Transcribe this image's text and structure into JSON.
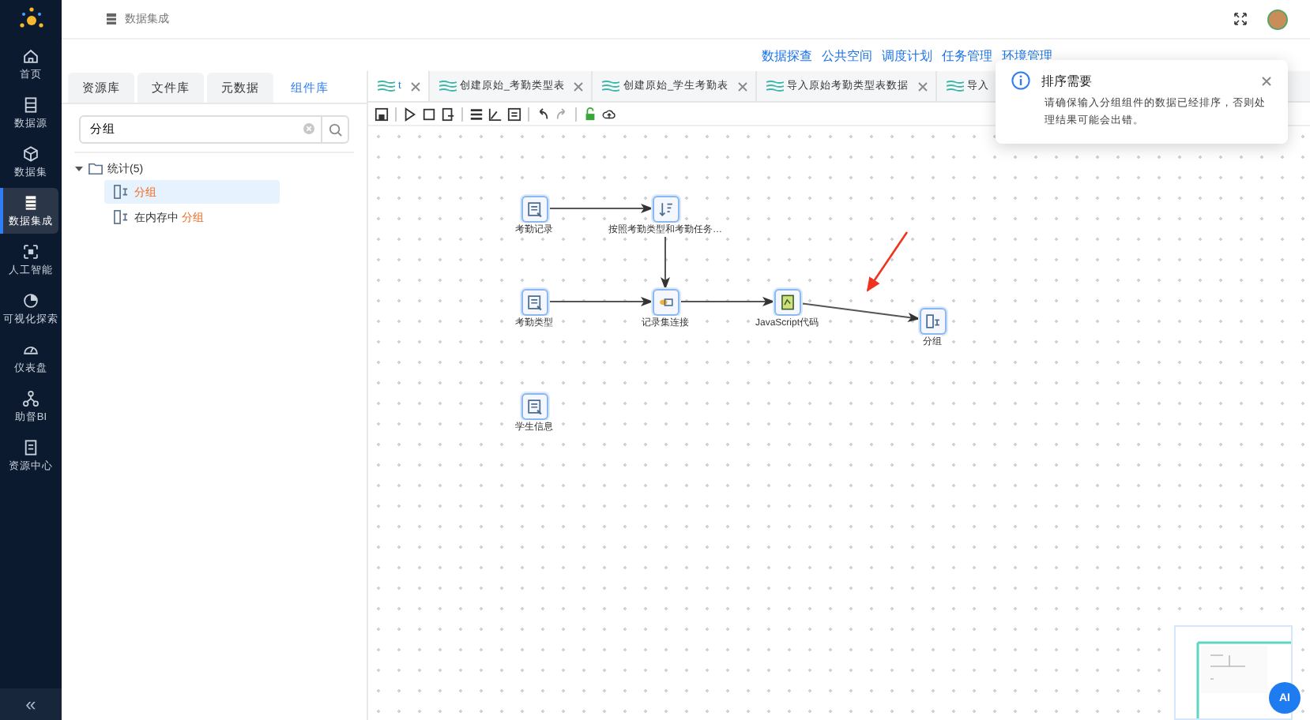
{
  "sidebar": {
    "items": [
      {
        "label": "首页",
        "selected": false
      },
      {
        "label": "数据源",
        "selected": false
      },
      {
        "label": "数据集",
        "selected": false
      },
      {
        "label": "数据集成",
        "selected": true
      },
      {
        "label": "人工智能",
        "selected": false
      },
      {
        "label": "可视化探索",
        "selected": false
      },
      {
        "label": "仪表盘",
        "selected": false
      },
      {
        "label": "助督BI",
        "selected": false
      },
      {
        "label": "资源中心",
        "selected": false
      }
    ],
    "collapse": "«"
  },
  "header": {
    "breadcrumb": "数据集成"
  },
  "top_links": [
    "数据探查",
    "公共空间",
    "调度计划",
    "任务管理",
    "环境管理"
  ],
  "library": {
    "tabs": [
      {
        "label": "资源库",
        "selected": false
      },
      {
        "label": "文件库",
        "selected": false
      },
      {
        "label": "元数据",
        "selected": false
      },
      {
        "label": "组件库",
        "selected": true
      }
    ],
    "search": {
      "value": "分组"
    },
    "tree": [
      {
        "label": "统计(5)",
        "expanded": true,
        "children": [
          {
            "match": "分组",
            "selected": true
          },
          {
            "prefix": "在内存中",
            "match": "分组",
            "selected": false
          }
        ]
      }
    ]
  },
  "editor_tabs": [
    {
      "label": "t",
      "selected": true
    },
    {
      "label": "创建原始_考勤类型表",
      "selected": false
    },
    {
      "label": "创建原始_学生考勤表",
      "selected": false
    },
    {
      "label": "导入原始考勤类型表数据",
      "selected": false
    },
    {
      "label": "导入",
      "selected": false
    }
  ],
  "nodes": [
    {
      "label": "考勤记录",
      "kind": "input"
    },
    {
      "label": "按照考勤类型和考勤任务…",
      "kind": "sort"
    },
    {
      "label": "考勤类型",
      "kind": "input"
    },
    {
      "label": "记录集连接",
      "kind": "join"
    },
    {
      "label": "JavaScript代码",
      "kind": "script"
    },
    {
      "label": "分组",
      "kind": "group"
    },
    {
      "label": "学生信息",
      "kind": "input"
    }
  ],
  "toast": {
    "title": "排序需要",
    "message": "请确保输入分组组件的数据已经排序，否则处理结果可能会出错。"
  },
  "ai_button": "AI"
}
